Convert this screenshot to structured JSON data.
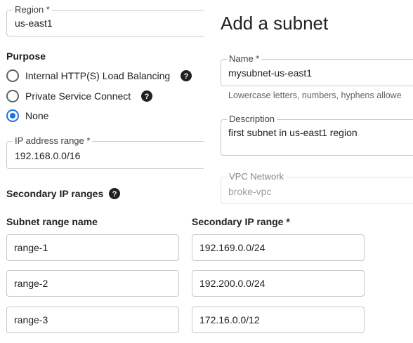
{
  "left": {
    "region": {
      "label": "Region *",
      "value": "us-east1"
    },
    "purpose": {
      "title": "Purpose",
      "options": [
        {
          "label": "Internal HTTP(S) Load Balancing",
          "checked": false,
          "help_icon": "help-circle-icon"
        },
        {
          "label": "Private Service Connect",
          "checked": false,
          "help_icon": "help-circle-icon"
        },
        {
          "label": "None",
          "checked": true
        }
      ]
    },
    "ip_range": {
      "label": "IP address range *",
      "value": "192.168.0.0/16"
    },
    "secondary": {
      "title": "Secondary IP ranges",
      "help_icon": "help-circle-icon",
      "col_name": "Subnet range name",
      "col_range": "Secondary IP range *",
      "rows": [
        {
          "name": "range-1",
          "range": "192.169.0.0/24"
        },
        {
          "name": "range-2",
          "range": "192.200.0.0/24"
        },
        {
          "name": "range-3",
          "range": "172.16.0.0/12"
        }
      ]
    }
  },
  "panel": {
    "title": "Add a subnet",
    "name": {
      "label": "Name *",
      "value": "mysubnet-us-east1",
      "hint": "Lowercase letters, numbers, hyphens allowe"
    },
    "description": {
      "label": "Description",
      "value": "first subnet in us-east1 region"
    },
    "vpc": {
      "label": "VPC Network",
      "value": "broke-vpc"
    }
  },
  "colors": {
    "accent": "#1a73e8",
    "text": "#202124",
    "border": "#c5c7ca"
  }
}
